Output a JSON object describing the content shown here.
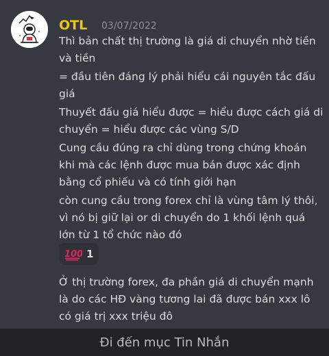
{
  "message": {
    "username": "OTL",
    "timestamp": "03/07/2022",
    "lines": [
      "Thì bản chất thị trường là giá di chuyển nhờ tiền và tiền",
      "= đầu tiên đáng lý phải hiểu cái nguyên tắc đấu giá",
      "Thuyết đấu giá hiểu được = hiểu được cách giá di chuyển = hiểu được các vùng S/D",
      "Cung cầu đúng ra chỉ dùng trong chứng khoán khi mà các lệnh được mua bán được xác định bằng cổ phiếu và có tính giới hạn",
      "còn cung cầu trong forex chỉ là vùng tâm lý thôi, vì nó bị giữ lại or di chuyển do 1 khối lệnh quá lớn từ 1 tổ chức nào đó"
    ],
    "reaction": {
      "emoji": "hundred-points-icon",
      "count": "1"
    },
    "followup": "Ở thị trường forex, đa phần giá di chuyển mạnh là do các HĐ vàng tương lai đã được bán xxx lô có giá trị xxx triệu đô"
  },
  "bottom_bar": {
    "label": "Đi đến mục Tin Nhắn"
  },
  "colors": {
    "username": "#f1c40f",
    "background": "#36393f",
    "text": "#dcddde",
    "timestamp": "#8e9297"
  }
}
